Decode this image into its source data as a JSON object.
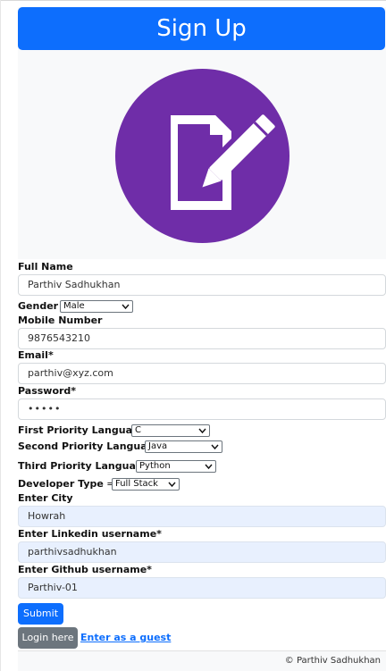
{
  "header": {
    "title": "Sign Up"
  },
  "logo": {
    "icon": "edit-document-icon",
    "color": "#6f2da8"
  },
  "form": {
    "full_name": {
      "label": "Full Name",
      "value": "Parthiv Sadhukhan"
    },
    "gender": {
      "label": "Gender",
      "value": "Male"
    },
    "mobile": {
      "label": "Mobile Number",
      "value": "9876543210"
    },
    "email": {
      "label": "Email*",
      "value": "parthiv@xyz.com"
    },
    "password": {
      "label": "Password*",
      "value": "•••••"
    },
    "first_lang": {
      "label": "First Priority Language",
      "value": "C"
    },
    "second_lang": {
      "label": "Second Priority Language",
      "value": "Java"
    },
    "third_lang": {
      "label": "Third Priority Language",
      "value": "Python"
    },
    "dev_type": {
      "label": "Developer Type",
      "value": "Full Stack"
    },
    "city": {
      "label": "Enter City",
      "value": "Howrah"
    },
    "linkedin": {
      "label": "Enter Linkedin username*",
      "value": "parthivsadhukhan"
    },
    "github": {
      "label": "Enter Github username*",
      "value": "Parthiv-01"
    },
    "arrow": "⇒"
  },
  "buttons": {
    "submit": "Submit",
    "login": "Login here",
    "guest": "Enter as a guest"
  },
  "footer": {
    "text": "© Parthiv Sadhukhan"
  },
  "colors": {
    "primary": "#0d6efd",
    "secondary": "#6c757d",
    "autofill": "#e8f0fe"
  }
}
